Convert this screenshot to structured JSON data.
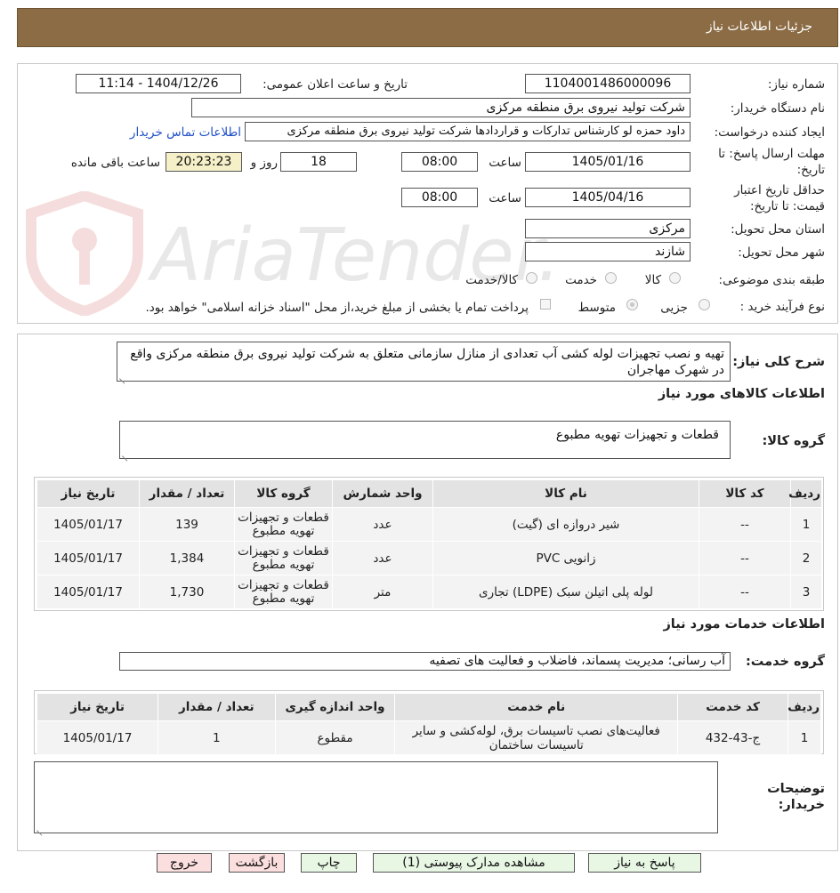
{
  "header": {
    "title": "جزئیات اطلاعات نیاز"
  },
  "watermark": {
    "text": "AriaTender.neT"
  },
  "details": {
    "need_number_label": "شماره نیاز:",
    "need_number": "1104001486000096",
    "announce_label": "تاریخ و ساعت اعلان عمومی:",
    "announce_value": "1404/12/26 - 11:14",
    "buyer_org_label": "نام دستگاه خریدار:",
    "buyer_org": "شرکت تولید نیروی برق منطقه مرکزی",
    "requester_label": "ایجاد کننده درخواست:",
    "requester": "داود حمزه لو کارشناس تدارکات و قراردادها شرکت تولید نیروی برق منطقه مرکزی",
    "contact_link": "اطلاعات تماس خریدار",
    "deadline_label_1": "مهلت ارسال پاسخ: تا",
    "deadline_label_2": "تاریخ:",
    "deadline_date": "1405/01/16",
    "time_label": "ساعت",
    "deadline_time": "08:00",
    "days_value": "18",
    "days_label": "روز و",
    "remaining_time": "20:23:23",
    "remaining_label": "ساعت باقی مانده",
    "validity_label_1": "حداقل تاریخ اعتبار",
    "validity_label_2": "قیمت: تا تاریخ:",
    "validity_date": "1405/04/16",
    "validity_time": "08:00",
    "province_label": "استان محل تحویل:",
    "province": "مرکزی",
    "city_label": "شهر محل تحویل:",
    "city": "شازند",
    "category_label": "طبقه بندی موضوعی:",
    "category_options": [
      "کالا",
      "خدمت",
      "کالا/خدمت"
    ],
    "process_label": "نوع فرآیند خرید :",
    "process_options": [
      "جزیی",
      "متوسط"
    ],
    "process_selected": "متوسط",
    "payment_note": "پرداخت تمام یا بخشی از مبلغ خرید،از محل \"اسناد خزانه اسلامی\" خواهد بود."
  },
  "summary": {
    "label": "شرح کلی نیاز:",
    "text": "تهیه و نصب تجهیزات لوله کشی آب تعدادی از منازل سازمانی متعلق به شرکت تولید نیروی برق منطقه مرکزی واقع در شهرک مهاجران"
  },
  "goods": {
    "section_title": "اطلاعات کالاهای مورد نیاز",
    "group_label": "گروه کالا:",
    "group_value": "قطعات و تجهیزات تهویه مطبوع",
    "columns": [
      "ردیف",
      "کد کالا",
      "نام کالا",
      "واحد شمارش",
      "گروه کالا",
      "تعداد / مقدار",
      "تاریخ نیاز"
    ],
    "rows": [
      {
        "row": "1",
        "code": "--",
        "name": "شیر دروازه ای (گیت)",
        "unit": "عدد",
        "group": "قطعات و تجهیزات تهویه مطبوع",
        "qty": "139",
        "date": "1405/01/17"
      },
      {
        "row": "2",
        "code": "--",
        "name": "زانویی PVC",
        "unit": "عدد",
        "group": "قطعات و تجهیزات تهویه مطبوع",
        "qty": "1,384",
        "date": "1405/01/17"
      },
      {
        "row": "3",
        "code": "--",
        "name": "لوله پلی اتیلن سبک (LDPE) تجاری",
        "unit": "متر",
        "group": "قطعات و تجهیزات تهویه مطبوع",
        "qty": "1,730",
        "date": "1405/01/17"
      }
    ]
  },
  "services": {
    "section_title": "اطلاعات خدمات مورد نیاز",
    "group_label": "گروه خدمت:",
    "group_value": "آب رسانی؛ مدیریت پسماند، فاضلاب و فعالیت های تصفیه",
    "columns": [
      "ردیف",
      "کد خدمت",
      "نام خدمت",
      "واحد اندازه گیری",
      "تعداد / مقدار",
      "تاریخ نیاز"
    ],
    "rows": [
      {
        "row": "1",
        "code": "ج-43-432",
        "name": "فعالیت‌های نصب تاسیسات برق، لوله‌کشی و سایر تاسیسات ساختمان",
        "unit": "مقطوع",
        "qty": "1",
        "date": "1405/01/17"
      }
    ]
  },
  "buyer_notes": {
    "label_1": "توضیحات",
    "label_2": "خریدار:",
    "text": ""
  },
  "buttons": {
    "reply": "پاسخ به نیاز",
    "view_docs": "مشاهده مدارک پیوستی (1)",
    "print": "چاپ",
    "back": "بازگشت",
    "exit": "خروج"
  }
}
